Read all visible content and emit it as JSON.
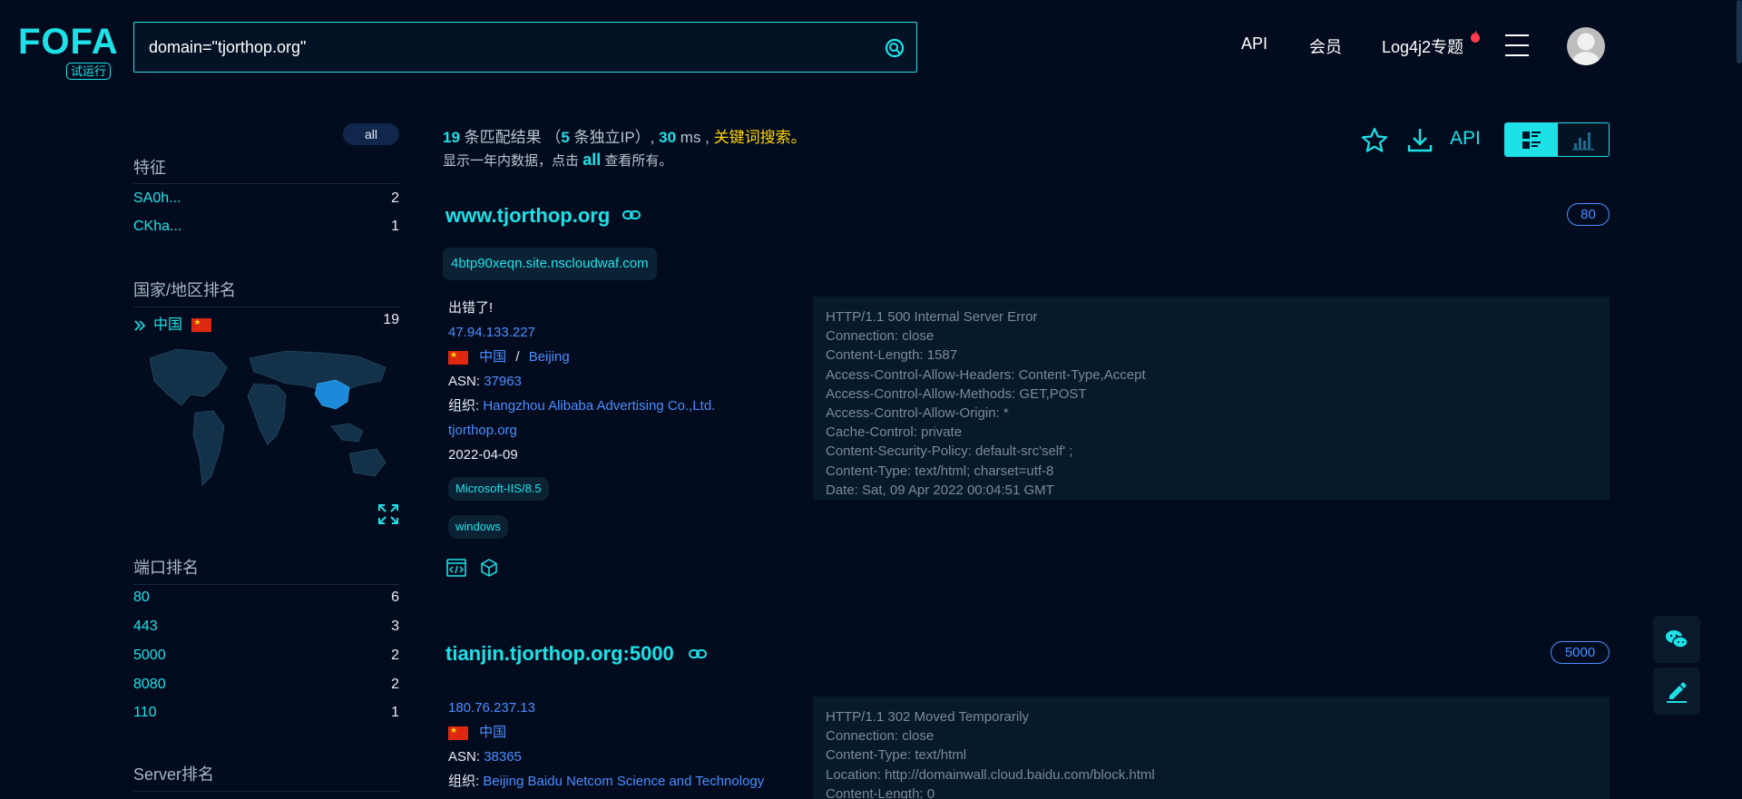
{
  "logo": {
    "text": "FOFA",
    "badge": "试运行"
  },
  "search": {
    "value": "domain=\"tjorthop.org\""
  },
  "nav": {
    "api": "API",
    "member": "会员",
    "log4j": "Log4j2专题"
  },
  "sidebar": {
    "all_label": "all",
    "features_title": "特征",
    "features": [
      {
        "label": "SA0h...",
        "count": "2"
      },
      {
        "label": "CKha...",
        "count": "1"
      }
    ],
    "country_title": "国家/地区排名",
    "countries": [
      {
        "label": "中国",
        "count": "19"
      }
    ],
    "port_title": "端口排名",
    "ports": [
      {
        "label": "80",
        "count": "6"
      },
      {
        "label": "443",
        "count": "3"
      },
      {
        "label": "5000",
        "count": "2"
      },
      {
        "label": "8080",
        "count": "2"
      },
      {
        "label": "110",
        "count": "1"
      }
    ],
    "server_title": "Server排名"
  },
  "stats": {
    "count": "19",
    "count_text": "条匹配结果",
    "ip_open": "（",
    "ip_count": "5",
    "ip_text": "条独立IP）,",
    "ms": "30",
    "ms_text": "ms ,",
    "keyword": "关键词搜索",
    "period": "。",
    "line2_pre": "显示一年内数据，点击",
    "line2_all": "all",
    "line2_post": "查看所有。"
  },
  "toolbar": {
    "api": "API"
  },
  "results": [
    {
      "host": "www.tjorthop.org",
      "port": "80",
      "subdomain": "4btp90xeqn.site.nscloudwaf.com",
      "title": "出错了!",
      "ip": "47.94.133.227",
      "country": "中国",
      "sep": "/",
      "city": "Beijing",
      "asn_label": "ASN:",
      "asn": "37963",
      "org_label": "组织:",
      "org": "Hangzhou Alibaba Advertising Co.,Ltd.",
      "domain": "tjorthop.org",
      "date": "2022-04-09",
      "tags": [
        "Microsoft-IIS/8.5",
        "windows"
      ],
      "banner": [
        "HTTP/1.1 500 Internal Server Error",
        "Connection: close",
        "Content-Length: 1587",
        "Access-Control-Allow-Headers: Content-Type,Accept",
        "Access-Control-Allow-Methods: GET,POST",
        "Access-Control-Allow-Origin: *",
        "Cache-Control: private",
        "Content-Security-Policy: default-src'self' ;",
        "Content-Type: text/html; charset=utf-8",
        "Date: Sat, 09 Apr 2022 00:04:51 GMT"
      ]
    },
    {
      "host": "tianjin.tjorthop.org:5000",
      "port": "5000",
      "ip": "180.76.237.13",
      "country": "中国",
      "asn_label": "ASN:",
      "asn": "38365",
      "org_label": "组织:",
      "org": "Beijing Baidu Netcom Science and Technology",
      "banner": [
        "HTTP/1.1 302 Moved Temporarily",
        "Connection: close",
        "Content-Type: text/html",
        "Location: http://domainwall.cloud.baidu.com/block.html",
        "Content-Length: 0"
      ]
    }
  ],
  "colors": {
    "accent": "#1ee1e8",
    "link": "#4c8dff",
    "keyword": "#ffd400",
    "bg": "#030c1e"
  }
}
